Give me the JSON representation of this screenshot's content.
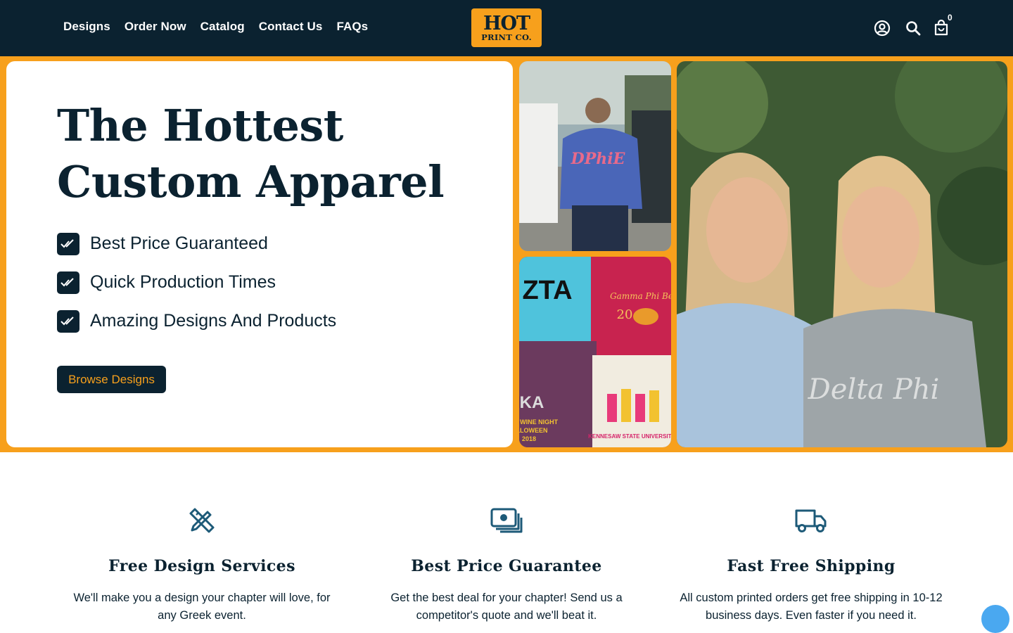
{
  "header": {
    "nav": [
      "Designs",
      "Order Now",
      "Catalog",
      "Contact Us",
      "FAQs"
    ],
    "logo_line1": "HOT",
    "logo_line2": "PRINT CO.",
    "cart_count": "0",
    "icons": [
      "account-icon",
      "search-icon",
      "cart-icon"
    ]
  },
  "hero": {
    "title_line1": "The Hottest",
    "title_line2": "Custom Apparel",
    "features": [
      "Best Price Guaranteed",
      "Quick Production Times",
      "Amazing Designs And Products"
    ],
    "cta": "Browse Designs",
    "photo_texts": {
      "shirt": "DPhiE",
      "pocket_letters": "ZTA",
      "pocket_script": "Gamma Phi Beta",
      "pocket_number": "20",
      "bottom_left_letters": "KA",
      "bottom_left_small": "Y WINE NIGHT",
      "bottom_left_small2": "LLOWEEN",
      "bottom_left_small3": "2018",
      "bottom_right_text": "KENNESAW STATE UNIVERSITY",
      "big_photo_text": "Delta Phi"
    }
  },
  "benefits": [
    {
      "icon": "design-tools-icon",
      "title": "Free Design Services",
      "desc_line1": "We'll make you a design your chapter will love, for",
      "desc_line2": "any Greek event."
    },
    {
      "icon": "cash-icon",
      "title": "Best Price Guarantee",
      "desc_line1": "Get the best deal for your chapter! Send us a",
      "desc_line2": "competitor's quote and we'll beat it."
    },
    {
      "icon": "truck-icon",
      "title": "Fast Free Shipping",
      "desc_line1": "All custom printed orders get free shipping in 10-12",
      "desc_line2": "business days. Even faster if you need it."
    }
  ],
  "colors": {
    "navy": "#0b2230",
    "orange": "#f7a01c",
    "chat": "#4aa8f0"
  }
}
